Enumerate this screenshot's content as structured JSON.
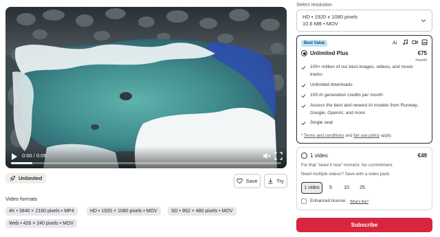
{
  "player": {
    "time": "0:00 / 0:06",
    "progress_fraction": 0.08
  },
  "badges": {
    "unlimited_label": "Unlimited"
  },
  "actions": {
    "save_label": "Save",
    "try_label": "Try"
  },
  "formats": {
    "title": "Video formats",
    "items": [
      "4K • 3840 × 2160 pixels • MP4",
      "HD • 1920 × 1080 pixels • MOV",
      "SD • 852 × 480 pixels • MOV",
      "Web • 426 × 240 pixels • MOV"
    ]
  },
  "resolution": {
    "label": "Select resolution",
    "selected_line1": "HD • 1920 x 1080 pixels",
    "selected_line2": "10.6 MB • MOV"
  },
  "plan": {
    "badge": "Best Value",
    "type_icons": [
      "ai-icon",
      "music-icon",
      "video-icon",
      "image-icon"
    ],
    "name": "Unlimited Plus",
    "price": "€75",
    "period": "/month",
    "selected": true,
    "features": [
      "100+ million of our best images, videos, and music tracks",
      "Unlimited downloads",
      "100 AI generation credits per month",
      "Access the best and newest AI models from Runway, Google, OpenAI, and more",
      "Single seat"
    ],
    "terms_prefix": "* ",
    "terms_link": "Terms and conditions",
    "terms_and": " and ",
    "policy_link": "fair use policy",
    "terms_suffix": " apply."
  },
  "single": {
    "name": "1 video",
    "price": "€49",
    "desc1": "For that \"need it now\" moment. No commitment.",
    "desc2": "Need multiple videos? Save with a video pack.",
    "quantities": [
      "1 video",
      "5",
      "10",
      "25"
    ],
    "selected_quantity": "1 video",
    "extended_label": "Enhanced license",
    "extended_link": "What's this?"
  },
  "subscribe_label": "Subscribe",
  "colors": {
    "subscribe": "#d7263d",
    "badge_bg": "#bfe3f5",
    "badge_text": "#0d4f73",
    "sea_turquoise": "#4f9a9a",
    "rock": "#3f4a4f"
  }
}
